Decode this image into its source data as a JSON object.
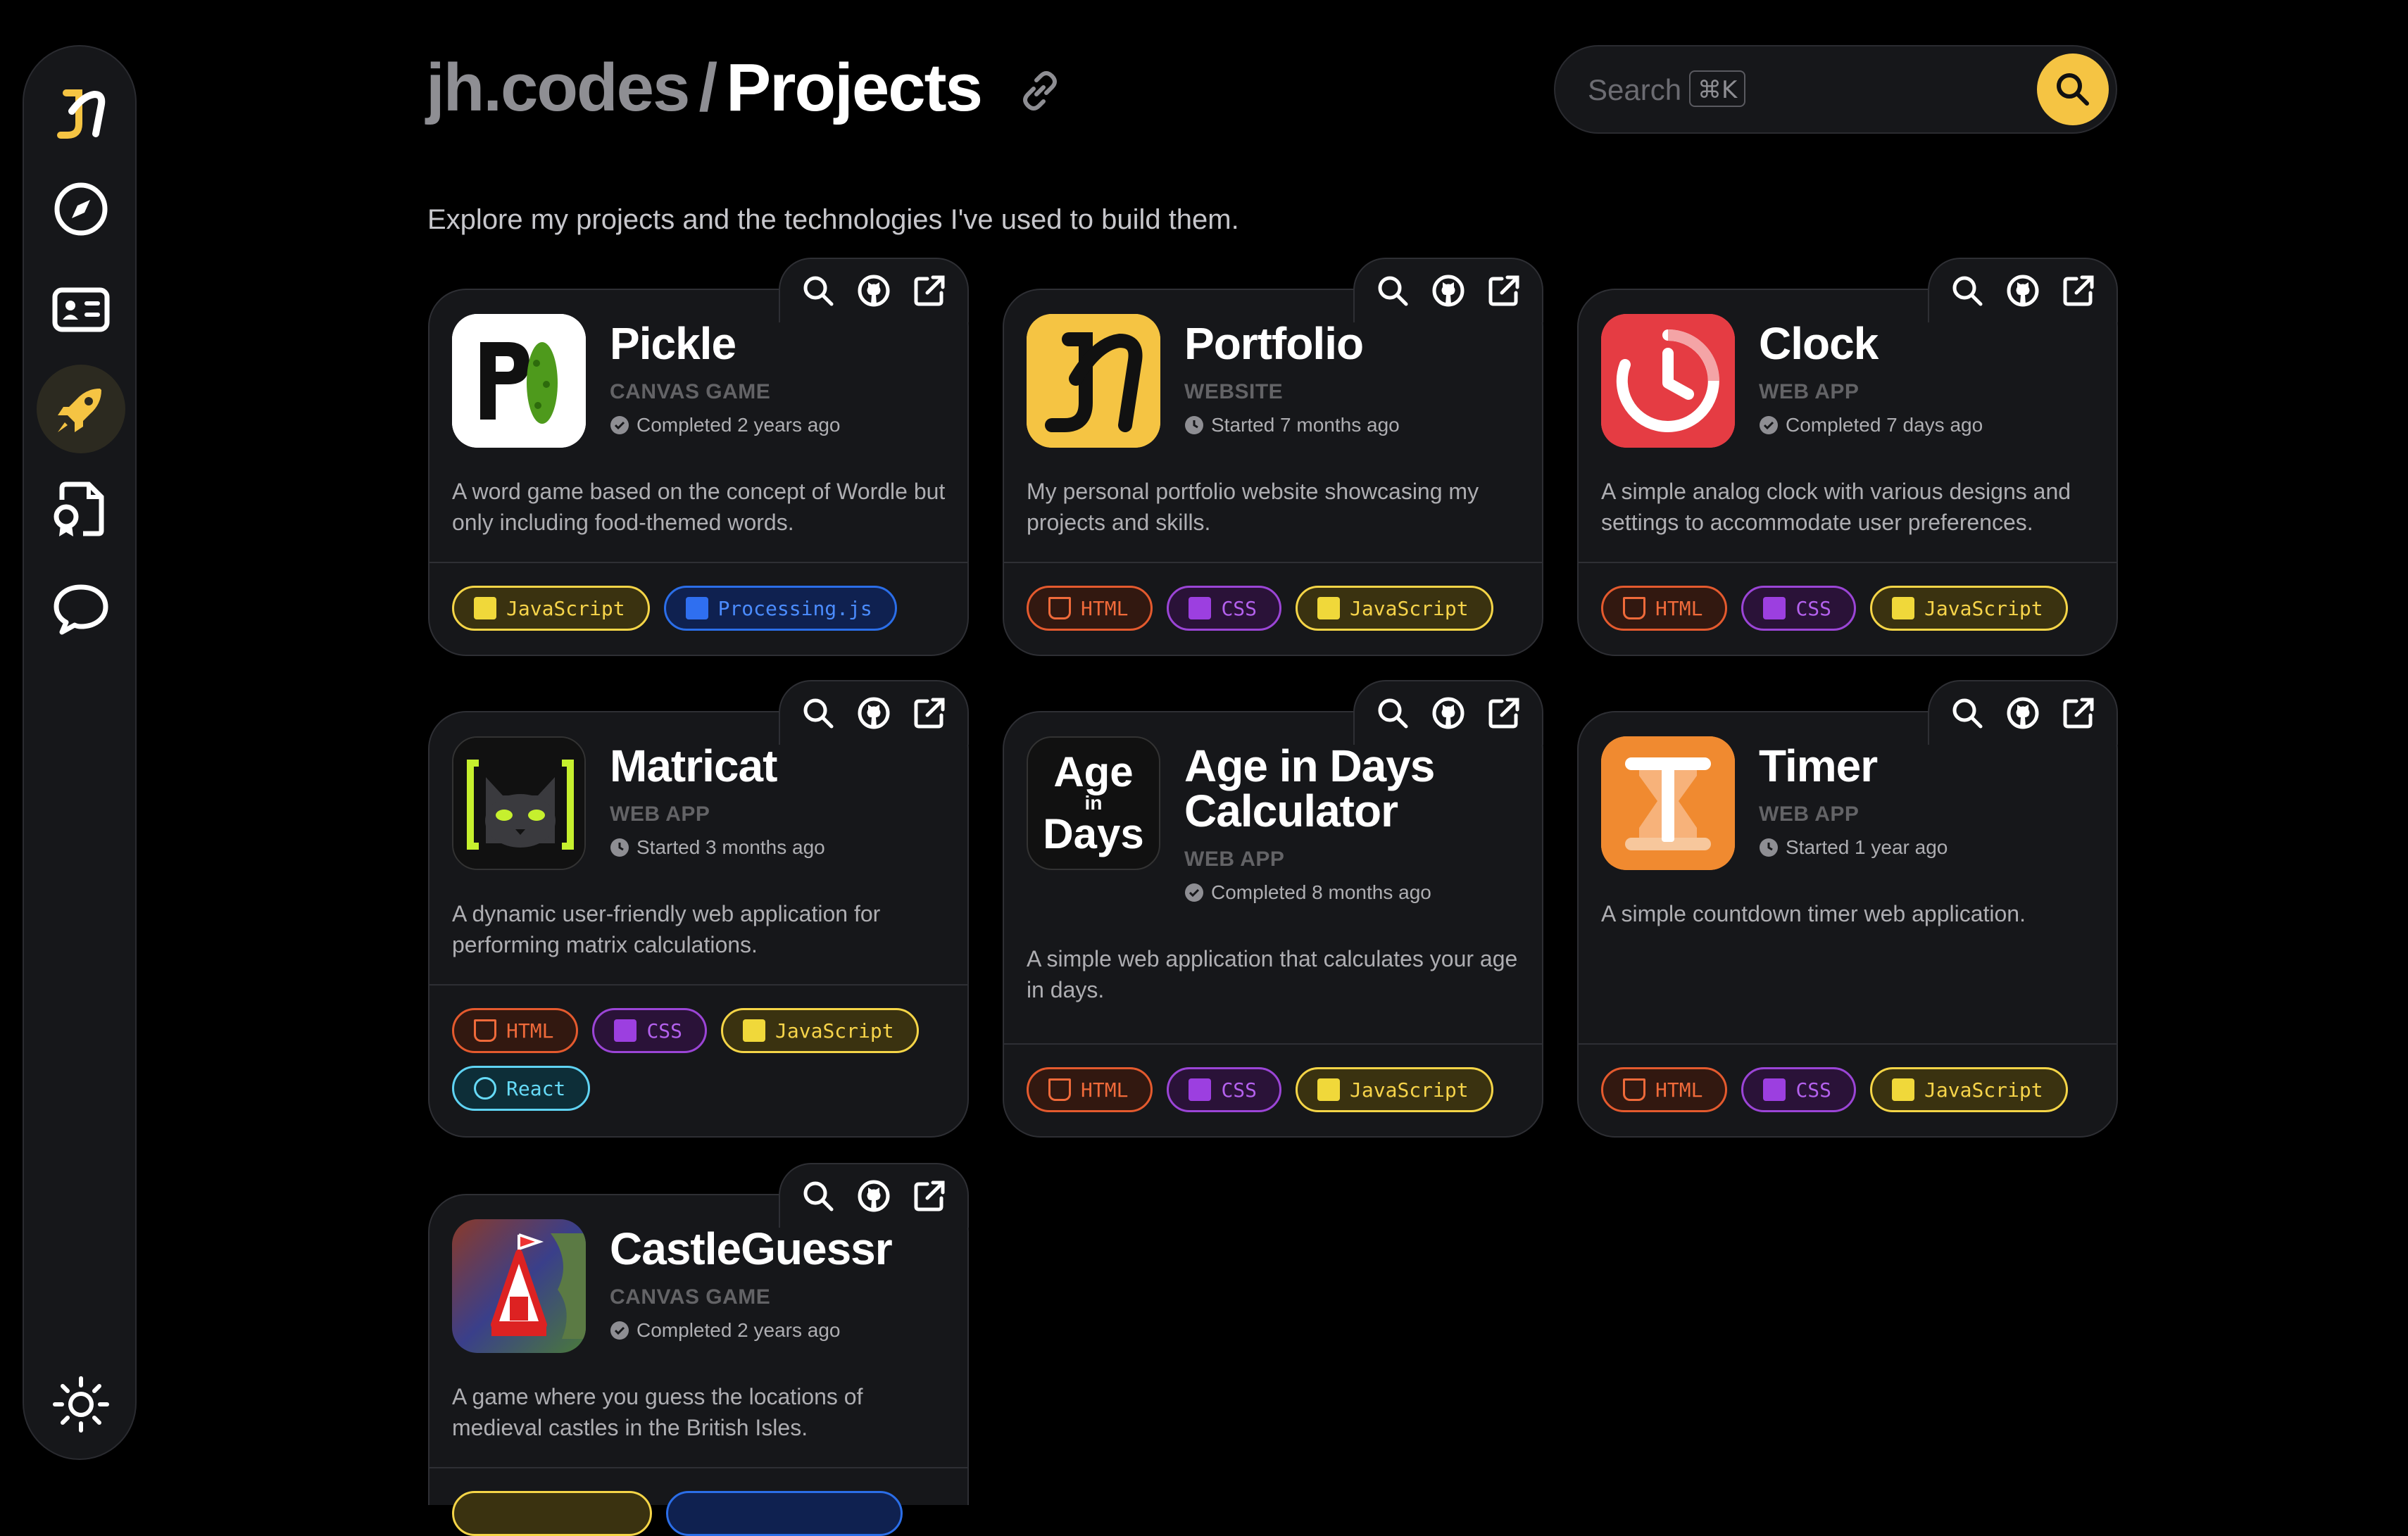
{
  "header": {
    "site": "jh.codes",
    "separator": "/",
    "page": "Projects"
  },
  "search": {
    "placeholder": "Search",
    "shortcut": "⌘K"
  },
  "subtitle": "Explore my projects and the technologies I've used to build them.",
  "colors": {
    "accent": "#f5c443",
    "background": "#000000",
    "card": "#16171a"
  },
  "sidebar": {
    "items": [
      {
        "name": "logo",
        "icon": "jh-logo-icon"
      },
      {
        "name": "explore",
        "icon": "compass-icon"
      },
      {
        "name": "about",
        "icon": "id-card-icon"
      },
      {
        "name": "projects",
        "icon": "rocket-icon",
        "active": true
      },
      {
        "name": "certificates",
        "icon": "certificate-icon"
      },
      {
        "name": "contact",
        "icon": "chat-bubble-icon"
      },
      {
        "name": "theme",
        "icon": "sun-icon"
      }
    ]
  },
  "projects": [
    {
      "name": "Pickle",
      "type": "CANVAS GAME",
      "status": "Completed 2 years ago",
      "description": "A word game based on the concept of Wordle but only including food-themed words.",
      "tags": [
        "JavaScript",
        "Processing.js"
      ]
    },
    {
      "name": "Portfolio",
      "type": "WEBSITE",
      "status": "Started 7 months ago",
      "description": "My personal portfolio website showcasing my projects and skills.",
      "tags": [
        "HTML",
        "CSS",
        "JavaScript"
      ]
    },
    {
      "name": "Clock",
      "type": "WEB APP",
      "status": "Completed 7 days ago",
      "description": "A simple analog clock with various designs and settings to accommodate user preferences.",
      "tags": [
        "HTML",
        "CSS",
        "JavaScript"
      ]
    },
    {
      "name": "Matricat",
      "type": "WEB APP",
      "status": "Started 3 months ago",
      "description": "A dynamic user-friendly web application for performing matrix calculations.",
      "tags": [
        "HTML",
        "CSS",
        "JavaScript",
        "React"
      ]
    },
    {
      "name_line1": "Age in Days",
      "name_line2": "Calculator",
      "type": "WEB APP",
      "status": "Completed 8 months ago",
      "description": "A simple web application that calculates your age in days.",
      "tags": [
        "HTML",
        "CSS",
        "JavaScript"
      ],
      "logo_text": [
        "Age",
        "in",
        "Days"
      ]
    },
    {
      "name": "Timer",
      "type": "WEB APP",
      "status": "Started 1 year ago",
      "description": "A simple countdown timer web application.",
      "tags": [
        "HTML",
        "CSS",
        "JavaScript"
      ]
    },
    {
      "name": "CastleGuessr",
      "type": "CANVAS GAME",
      "status": "Completed 2 years ago",
      "description": "A game where you guess the locations of medieval castles in the British Isles."
    }
  ]
}
